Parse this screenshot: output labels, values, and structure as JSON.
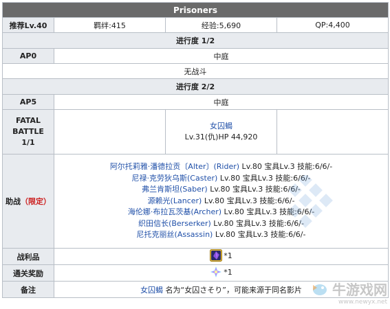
{
  "title": "Prisoners",
  "recommend": {
    "label": "推荐Lv.40",
    "bond": "羁绊:415",
    "exp": "经验:5,690",
    "qp": "QP:4,400"
  },
  "progress1": {
    "label": "进行度 1/2",
    "ap_label": "AP0",
    "location": "中庭",
    "note": "无战斗"
  },
  "progress2": {
    "label": "进行度 2/2",
    "ap_label": "AP5",
    "location": "中庭"
  },
  "fatal": {
    "label_line1": "FATAL",
    "label_line2": "BATTLE",
    "label_line3": "1/1",
    "enemy_name": "女囚蝎",
    "enemy_stats": "Lv.31(仇)HP 44,920"
  },
  "support": {
    "label": "助战",
    "limited": "（限定）",
    "servants": [
      {
        "name": "阿尔托莉雅·潘德拉贡〔Alter〕(Rider)",
        "stats": " Lv.80 宝具Lv.3 技能:6/6/-"
      },
      {
        "name": "尼禄·克劳狄乌斯(Caster)",
        "stats": " Lv.80 宝具Lv.3 技能:6/6/-"
      },
      {
        "name": "弗兰肯斯坦(Saber)",
        "stats": " Lv.80 宝具Lv.3 技能:6/6/-"
      },
      {
        "name": "源赖光(Lancer)",
        "stats": " Lv.80 宝具Lv.3 技能:6/6/-"
      },
      {
        "name": "海伦娜·布拉瓦茨基(Archer)",
        "stats": " Lv.80 宝具Lv.3 技能:6/6/-"
      },
      {
        "name": "织田信长(Berserker)",
        "stats": " Lv.80 宝具Lv.3 技能:6/6/-"
      },
      {
        "name": "尼托克丽丝(Assassin)",
        "stats": " Lv.80 宝具Lv.3 技能:6/6/-"
      }
    ]
  },
  "loot": {
    "label": "战利品",
    "count": "*1",
    "icon": "purple-gem-icon"
  },
  "clear": {
    "label": "通关奖励",
    "count": "*1",
    "icon": "saint-quartz-icon"
  },
  "remark": {
    "label": "备注",
    "link": "女囚蝎",
    "text": " 名为“女囚さそり”，可能来源于同名影片"
  },
  "watermark": {
    "name": "牛游戏网",
    "url": "www.newyx.net"
  }
}
